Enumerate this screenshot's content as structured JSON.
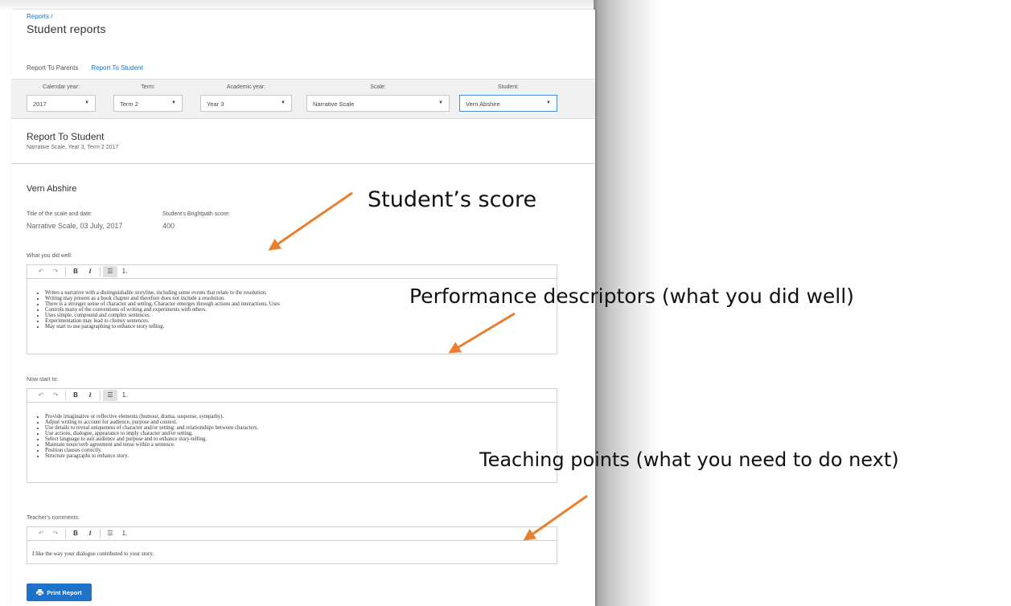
{
  "breadcrumb": "Reports /",
  "page_title": "Student reports",
  "tabs": [
    {
      "label": "Report To Parents",
      "active": false
    },
    {
      "label": "Report To Student",
      "active": true
    }
  ],
  "filters": [
    {
      "label": "Calendar year:",
      "value": "2017"
    },
    {
      "label": "Term:",
      "value": "Term 2"
    },
    {
      "label": "Academic year:",
      "value": "Year 3"
    },
    {
      "label": "Scale:",
      "value": "Narrative Scale"
    },
    {
      "label": "Student:",
      "value": "Vern Abshire"
    }
  ],
  "report": {
    "title": "Report To Student",
    "subtitle": "Narrative Scale, Year 3, Term 2 2017"
  },
  "student": {
    "name": "Vern Abshire",
    "scale_date_label": "Title of the scale and date:",
    "scale_date_value": "Narrative Scale, 03 July, 2017",
    "score_label": "Student's Brightpath score:",
    "score_value": "400"
  },
  "did_well": {
    "label": "What you did well:",
    "items": [
      "Writes a narrative with a distinguishable storyline, including some events that relate to the resolution.",
      "Writing may present as a book chapter and therefore does not include a resolution.",
      "There is a stronger sense of character and setting. Character emerges through actions and interactions. Uses",
      "Controls many of the conventions of writing and experiments with others.",
      "Uses simple, compound and complex sentences.",
      "Experimentation may lead to clumsy sentences.",
      "May start to use paragraphing to enhance story telling."
    ]
  },
  "start_to": {
    "label": "Now start to:",
    "items": [
      "Provide imaginative or reflective elements (humour, drama, suspense, sympathy).",
      "Adjust writing to account for audience, purpose and context.",
      "Use details to reveal uniqueness of character and/or setting: and relationships between characters.",
      "Use actions, dialogue, appearance to imply character and/or setting.",
      "Select language to suit audience and purpose and to enhance story-telling.",
      "Maintain noun/verb agreement and tense within a sentence.",
      "Position clauses correctly.",
      "Structure paragraphs to enhance story."
    ]
  },
  "teacher": {
    "label": "Teacher's comments:",
    "text": "I like the way your dialogue contributed to your story."
  },
  "toolbar": {
    "undo": "↶",
    "redo": "↷",
    "bold": "B",
    "italic": "I",
    "bullet_list": "☰",
    "numbered_list": "⒈"
  },
  "print_button": "Print Report",
  "annotations": {
    "score": "Student’s score",
    "descriptors": "Performance descriptors (what you did well)",
    "teaching": "Teaching points (what you need to do next)"
  },
  "colors": {
    "accent": "#1e73c8",
    "arrow": "#e87f2e"
  }
}
